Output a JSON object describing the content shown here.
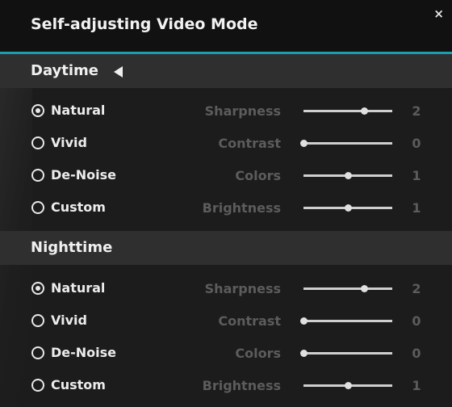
{
  "window": {
    "title": "Self-adjusting Video Mode",
    "close_glyph": "×",
    "accent_color": "#1a9fb0"
  },
  "daytime": {
    "label": "Daytime",
    "modes": [
      {
        "label": "Natural",
        "selected": true
      },
      {
        "label": "Vivid",
        "selected": false
      },
      {
        "label": "De-Noise",
        "selected": false
      },
      {
        "label": "Custom",
        "selected": false
      }
    ],
    "params": [
      {
        "label": "Sharpness",
        "value": "2",
        "level": 0.68
      },
      {
        "label": "Contrast",
        "value": "0",
        "level": 0.0
      },
      {
        "label": "Colors",
        "value": "1",
        "level": 0.5
      },
      {
        "label": "Brightness",
        "value": "1",
        "level": 0.5
      }
    ]
  },
  "nighttime": {
    "label": "Nighttime",
    "modes": [
      {
        "label": "Natural",
        "selected": true
      },
      {
        "label": "Vivid",
        "selected": false
      },
      {
        "label": "De-Noise",
        "selected": false
      },
      {
        "label": "Custom",
        "selected": false
      }
    ],
    "params": [
      {
        "label": "Sharpness",
        "value": "2",
        "level": 0.68
      },
      {
        "label": "Contrast",
        "value": "0",
        "level": 0.0
      },
      {
        "label": "Colors",
        "value": "0",
        "level": 0.0
      },
      {
        "label": "Brightness",
        "value": "1",
        "level": 0.5
      }
    ]
  }
}
